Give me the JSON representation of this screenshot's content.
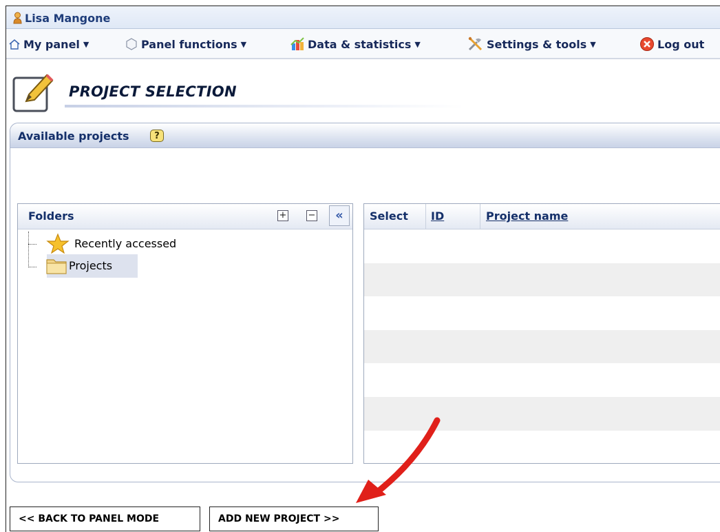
{
  "user": {
    "name": "Lisa Mangone"
  },
  "menu": {
    "items": [
      {
        "label": "My panel",
        "icon": "home-icon",
        "has_dropdown": true
      },
      {
        "label": "Panel functions",
        "icon": "hexagon-icon",
        "has_dropdown": true
      },
      {
        "label": "Data & statistics",
        "icon": "chart-icon",
        "has_dropdown": true
      },
      {
        "label": "Settings & tools",
        "icon": "tools-icon",
        "has_dropdown": true
      },
      {
        "label": "Log out",
        "icon": "logout-icon",
        "has_dropdown": false
      }
    ]
  },
  "page": {
    "title": "PROJECT SELECTION"
  },
  "panel": {
    "header": "Available projects",
    "help_glyph": "?"
  },
  "folders": {
    "header": "Folders",
    "expand_glyph": "+",
    "collapse_glyph": "−",
    "hide_glyph": "«",
    "tree": [
      {
        "label": "Recently accessed",
        "icon": "star-icon"
      },
      {
        "label": "Projects",
        "icon": "folder-icon",
        "selected": true
      }
    ]
  },
  "grid": {
    "columns": [
      {
        "label": "Select",
        "sortable": false
      },
      {
        "label": "ID",
        "sortable": true
      },
      {
        "label": "Project name",
        "sortable": true
      }
    ],
    "rows": []
  },
  "buttons": {
    "back": "<< BACK TO PANEL MODE",
    "add": "ADD NEW PROJECT >>"
  },
  "colors": {
    "accent": "#15306a",
    "annotation_arrow": "#e0201a"
  }
}
